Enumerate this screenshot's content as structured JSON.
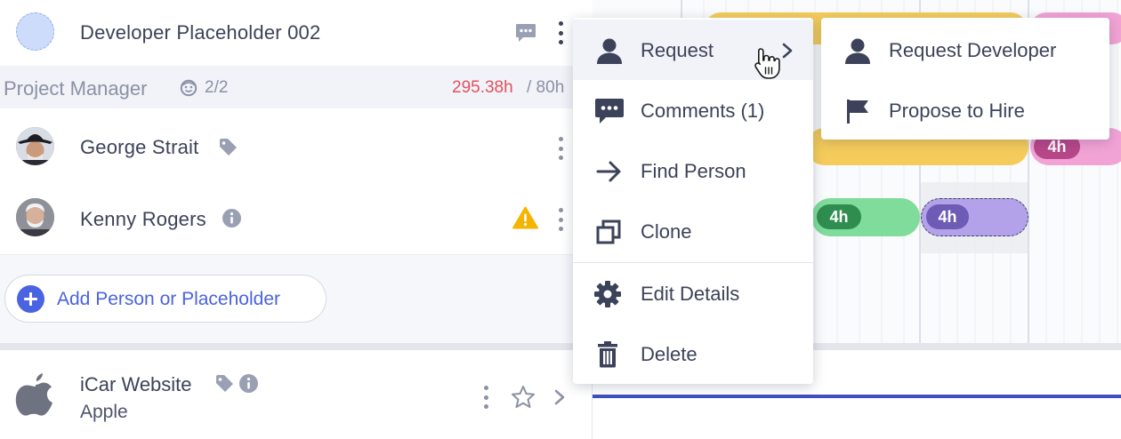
{
  "people": {
    "placeholder": {
      "name": "Developer Placeholder 002"
    },
    "section": {
      "title": "Project Manager",
      "count": "2/2",
      "hours_used": "295.38h",
      "hours_total": "/ 80h"
    },
    "george": {
      "name": "George Strait"
    },
    "kenny": {
      "name": "Kenny Rogers"
    }
  },
  "add_button": {
    "label": "Add Person or Placeholder"
  },
  "project": {
    "name": "iCar Website",
    "client": "Apple"
  },
  "timeline": {
    "pills": [
      "4h",
      "4h",
      "4h"
    ]
  },
  "context_menu": {
    "items": [
      {
        "label": "Request",
        "icon": "person-icon"
      },
      {
        "label": "Comments (1)",
        "icon": "comment-icon"
      },
      {
        "label": "Find Person",
        "icon": "arrow-right-icon"
      },
      {
        "label": "Clone",
        "icon": "clone-icon"
      },
      {
        "label": "Edit Details",
        "icon": "gear-icon"
      },
      {
        "label": "Delete",
        "icon": "trash-icon"
      }
    ]
  },
  "submenu": {
    "items": [
      {
        "label": "Request Developer",
        "icon": "person-icon"
      },
      {
        "label": "Propose to Hire",
        "icon": "flag-icon"
      }
    ]
  },
  "colors": {
    "accent": "#4a63e0",
    "over_budget": "#e05260",
    "text": "#3c4259",
    "muted": "#8b91a5",
    "bar_yellow": "#f5cc5c",
    "bar_pink": "#f2a3d6",
    "bar_green": "#7fdc9b",
    "bar_purple": "#b3a1ea"
  }
}
